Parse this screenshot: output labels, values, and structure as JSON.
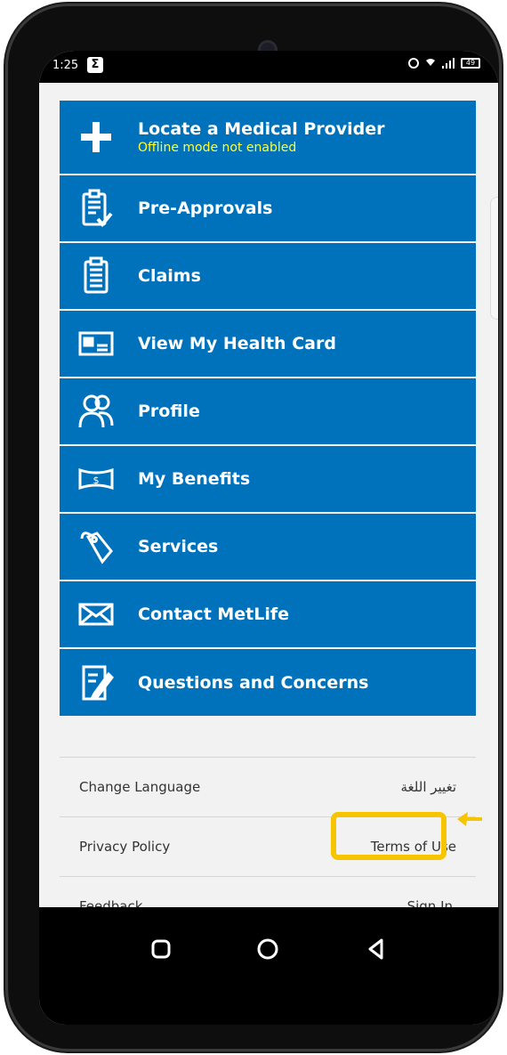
{
  "status_bar": {
    "time": "1:25",
    "notification": "Σ",
    "battery": "49"
  },
  "menu": [
    {
      "id": "locate",
      "label": "Locate a Medical Provider",
      "sub": "Offline mode not enabled",
      "icon": "plus-icon"
    },
    {
      "id": "pre-approvals",
      "label": "Pre-Approvals",
      "icon": "clipboard-check-icon"
    },
    {
      "id": "claims",
      "label": "Claims",
      "icon": "clipboard-icon"
    },
    {
      "id": "health-card",
      "label": "View My Health Card",
      "icon": "id-card-icon"
    },
    {
      "id": "profile",
      "label": "Profile",
      "icon": "people-icon"
    },
    {
      "id": "benefits",
      "label": "My Benefits",
      "icon": "money-icon"
    },
    {
      "id": "services",
      "label": "Services",
      "icon": "tag-icon"
    },
    {
      "id": "contact",
      "label": "Contact MetLife",
      "icon": "envelope-icon"
    },
    {
      "id": "questions",
      "label": "Questions and Concerns",
      "icon": "edit-document-icon"
    }
  ],
  "links": {
    "change_language": "Change Language",
    "arabic_language": "تغيير اللغة",
    "privacy_policy": "Privacy Policy",
    "terms_of_use": "Terms of Use",
    "feedback": "Feedback",
    "sign_in": "Sign In"
  },
  "colors": {
    "menu_bg": "#0072bc",
    "sub_text": "#ffff33",
    "highlight": "#f7c400"
  }
}
